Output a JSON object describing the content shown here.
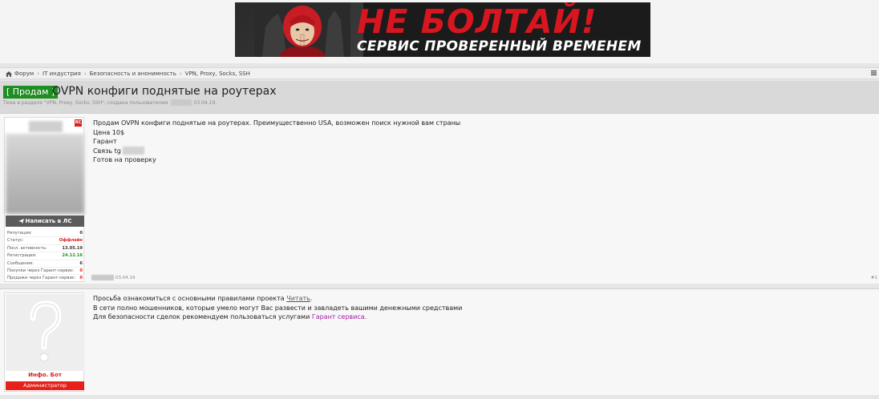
{
  "banner": {
    "headline": "НЕ БОЛТАЙ!",
    "tagline": "СЕРВИС ПРОВЕРЕННЫЙ ВРЕМЕНЕМ",
    "colors": {
      "headline": "#d8161f",
      "background": "#1b1b1b"
    }
  },
  "breadcrumb": {
    "items": [
      "Форум",
      "IT индустрия",
      "Безопасность и анонимность",
      "VPN, Proxy, Socks, SSH"
    ]
  },
  "thread": {
    "prefix": "[ Продам ]",
    "title": "OVPN конфиги поднятые на роутерах",
    "meta_prefix": "Тема в разделе \"VPN, Proxy, Socks, SSH\", создана пользователем",
    "meta_date": "03.04.19."
  },
  "post1": {
    "user": {
      "badge": "RC",
      "pm_button": "Написать в ЛС",
      "stats": [
        {
          "label": "Репутация:",
          "value": "0",
          "tone": "normal"
        },
        {
          "label": "Статус:",
          "value": "Оффлайн",
          "tone": "red"
        },
        {
          "label": "Посл. активность:",
          "value": "13.05.19",
          "tone": "normal"
        },
        {
          "label": "Регистрация:",
          "value": "24.12.16",
          "tone": "green"
        },
        {
          "label": "Сообщения:",
          "value": "6",
          "tone": "normal"
        },
        {
          "label": "Покупки через Гарант-сервис:",
          "value": "0",
          "tone": "red"
        },
        {
          "label": "Продажи через Гарант-сервис:",
          "value": "0",
          "tone": "red"
        }
      ]
    },
    "lines": [
      "Продам OVPN конфиги поднятые на роутерах. Преимущественно USA, возможен поиск нужной вам страны",
      "Цена 10$",
      "Гарант",
      "Связь tg",
      "Готов на проверку"
    ],
    "date": "03.04.19",
    "number": "#1"
  },
  "post2": {
    "user": {
      "name": "Инфо. Бот",
      "role": "Администратор"
    },
    "line1_text": "Просьба ознакомиться с основными правилами проекта",
    "line1_link": "Читать",
    "line1_end": ".",
    "line2": "В сети полно мошенников, которые умело могут Вас развести и завладеть вашими денежными средствами",
    "line3_text": "Для безопасности сделок рекомендуем пользоваться услугами",
    "line3_link": "Гарант сервиса",
    "line3_end": "."
  }
}
